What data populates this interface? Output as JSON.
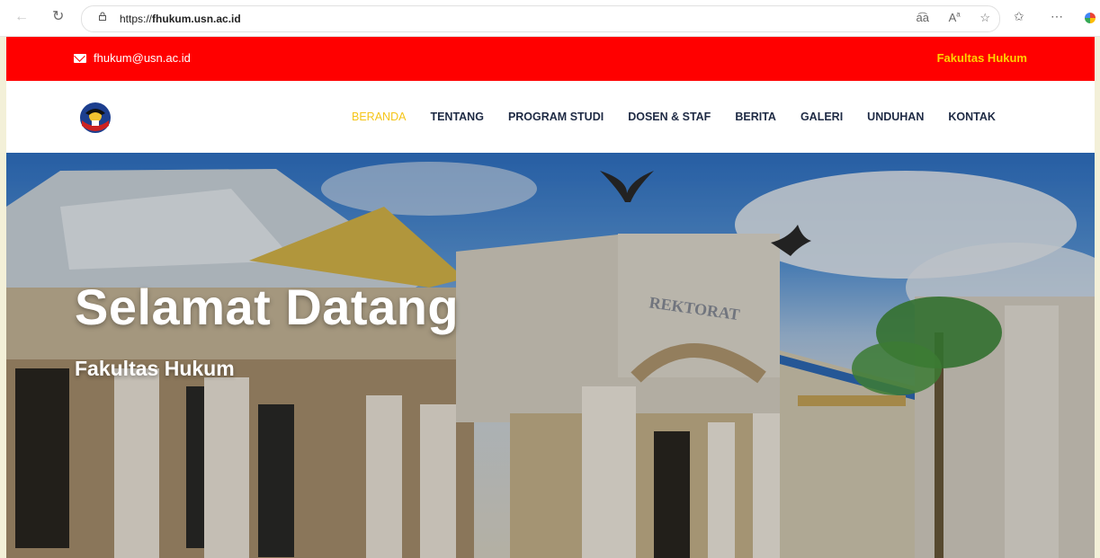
{
  "browser": {
    "url_scheme": "https://",
    "url_host": "fhukum.usn.ac.id",
    "toolbar_icons": [
      "read-aloud-icon",
      "text-size-icon",
      "favorite-star-icon"
    ]
  },
  "topbar": {
    "email": "fhukum@usn.ac.id",
    "faculty_label": "Fakultas Hukum",
    "colors": {
      "background": "#ff0000",
      "faculty_text": "#ffd200"
    }
  },
  "nav": {
    "items": [
      {
        "label": "BERANDA",
        "active": true
      },
      {
        "label": "TENTANG"
      },
      {
        "label": "PROGRAM STUDI"
      },
      {
        "label": "DOSEN & STAF"
      },
      {
        "label": "BERITA"
      },
      {
        "label": "GALERI"
      },
      {
        "label": "UNDUHAN"
      },
      {
        "label": "KONTAK"
      }
    ],
    "colors": {
      "active": "#f5c518",
      "default": "#1e2a44"
    }
  },
  "hero": {
    "title": "Selamat Datang",
    "subtitle": "Fakultas Hukum",
    "building_sign": "REKTORAT"
  }
}
